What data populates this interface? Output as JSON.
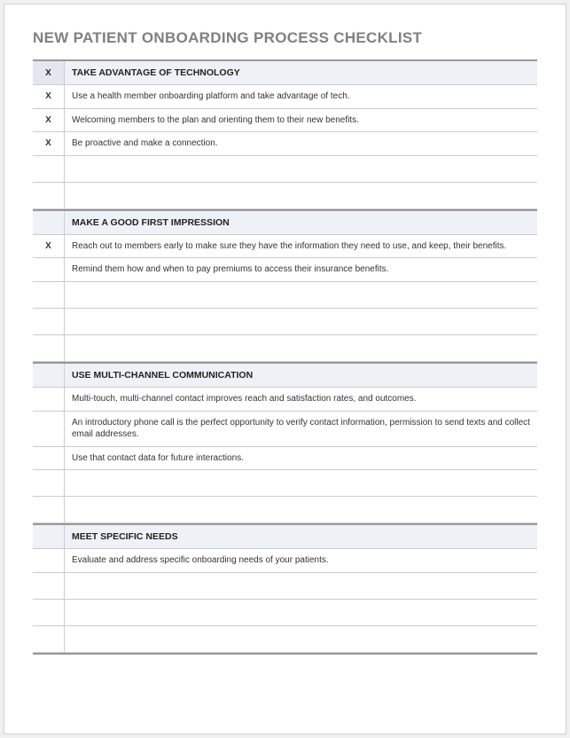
{
  "title": "NEW PATIENT ONBOARDING PROCESS CHECKLIST",
  "check_mark": "X",
  "sections": [
    {
      "header_check": "X",
      "header": "TAKE ADVANTAGE OF TECHNOLOGY",
      "rows": [
        {
          "check": "X",
          "text": "Use a health member onboarding platform and take advantage of tech."
        },
        {
          "check": "X",
          "text": "Welcoming members to the plan and orienting them to their new benefits."
        },
        {
          "check": "X",
          "text": "Be proactive and make a connection."
        },
        {
          "check": "",
          "text": ""
        },
        {
          "check": "",
          "text": ""
        }
      ]
    },
    {
      "header_check": "",
      "header": "MAKE A GOOD FIRST IMPRESSION",
      "rows": [
        {
          "check": "X",
          "text": "Reach out to members early to make sure they have the information they need to use, and keep, their benefits."
        },
        {
          "check": "",
          "text": "Remind them how and when to pay premiums to access their insurance benefits."
        },
        {
          "check": "",
          "text": ""
        },
        {
          "check": "",
          "text": ""
        },
        {
          "check": "",
          "text": ""
        }
      ]
    },
    {
      "header_check": "",
      "header": "USE MULTI-CHANNEL COMMUNICATION",
      "rows": [
        {
          "check": "",
          "text": "Multi-touch, multi-channel contact improves reach and satisfaction rates, and outcomes."
        },
        {
          "check": "",
          "text": "An introductory phone call is the perfect opportunity to verify contact information, permission to send texts and collect email addresses."
        },
        {
          "check": "",
          "text": "Use that contact data for future interactions."
        },
        {
          "check": "",
          "text": ""
        },
        {
          "check": "",
          "text": ""
        }
      ]
    },
    {
      "header_check": "",
      "header": "MEET SPECIFIC NEEDS",
      "rows": [
        {
          "check": "",
          "text": "Evaluate and address specific onboarding needs of your patients."
        },
        {
          "check": "",
          "text": ""
        },
        {
          "check": "",
          "text": ""
        },
        {
          "check": "",
          "text": ""
        }
      ]
    }
  ]
}
